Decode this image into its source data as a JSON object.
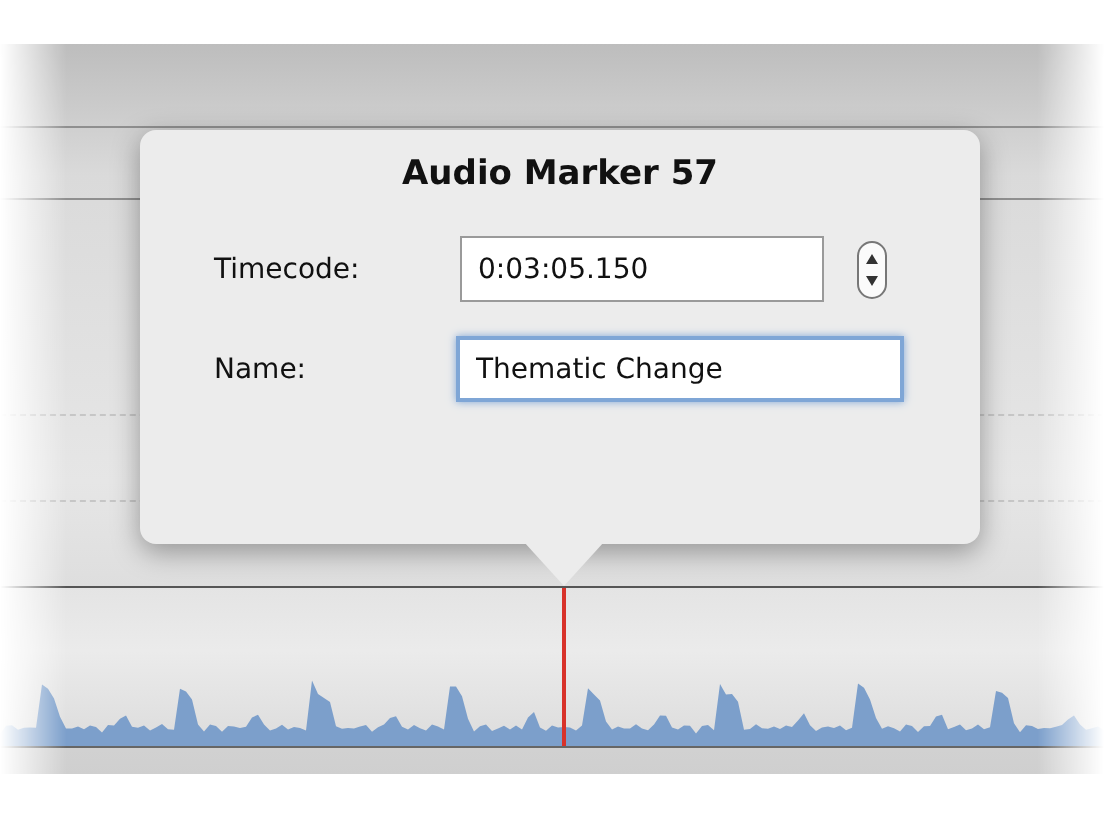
{
  "popover": {
    "title": "Audio Marker 57",
    "fields": [
      {
        "label": "Timecode:",
        "value": "0:03:05.150",
        "kind": "stepper",
        "focused": false
      },
      {
        "label": "Name:",
        "value": "Thematic Change",
        "kind": "text",
        "focused": true
      }
    ]
  }
}
